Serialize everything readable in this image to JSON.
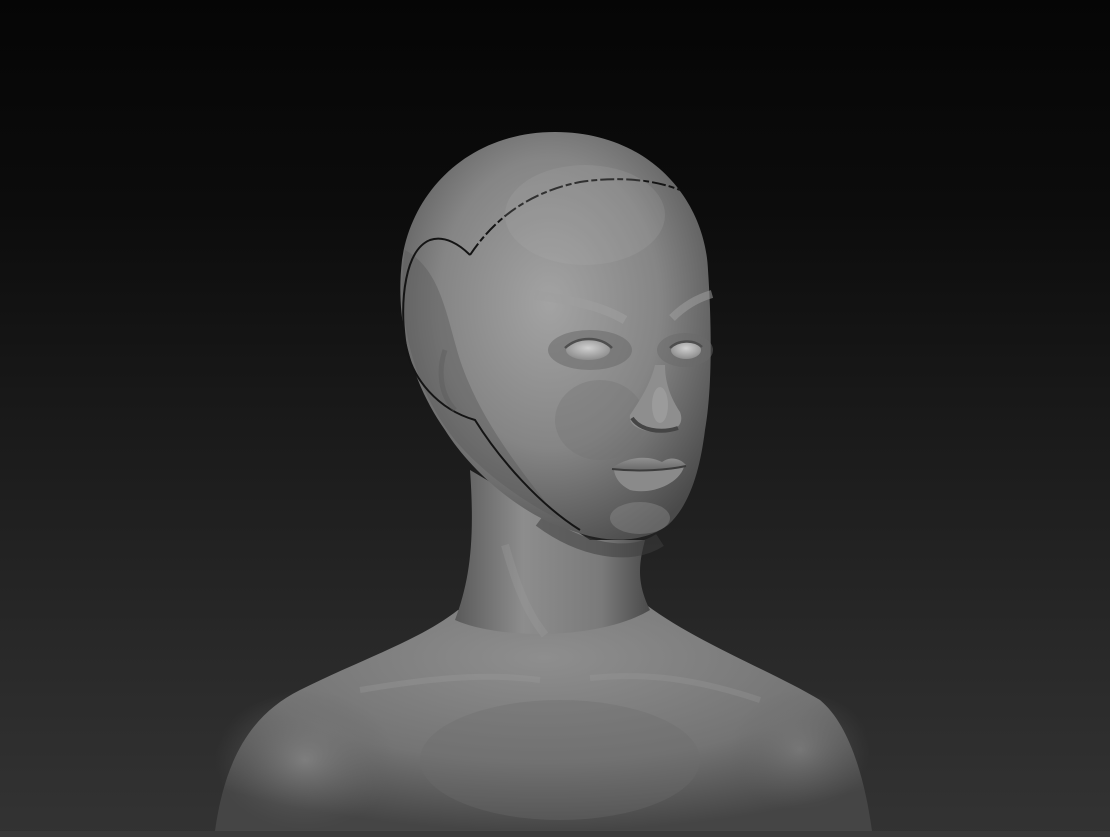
{
  "canvas": {
    "background_top": "#050505",
    "background_bottom": "#333333",
    "model_base_color": "#7a7a7a",
    "model_highlight_color": "#a6a6a6",
    "model_shadow_color": "#3c3c3c",
    "mask_line_color": "#141414"
  }
}
